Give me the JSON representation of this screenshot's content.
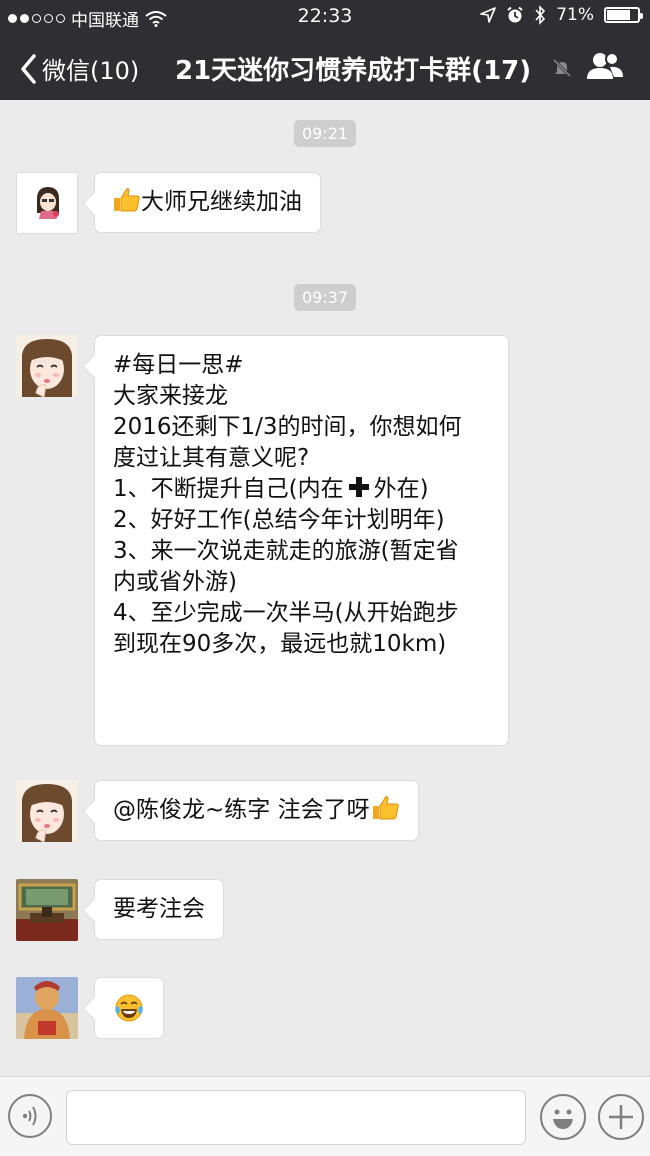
{
  "status_bar": {
    "carrier": "中国联通",
    "time": "22:33",
    "battery_text": "71%",
    "battery_level": 0.71
  },
  "nav": {
    "back_label": "微信(10)",
    "title": "21天迷你习惯养成打卡群(17)"
  },
  "messages": [
    {
      "timestamp": "09:21"
    },
    {
      "text": "大师兄继续加油",
      "lead_icon": "thumbs-up"
    },
    {
      "timestamp": "09:37"
    },
    {
      "lines": [
        "#每日一思#",
        "大家来接龙",
        "2016还剩下1/3的时间，你想如何",
        "度过让其有意义呢?",
        "1、不断提升自己(内在",
        "外在)",
        "2、好好工作(总结今年计划明年)",
        "3、来一次说走就走的旅游(暂定省",
        "内或省外游)",
        "4、至少完成一次半马(从开始跑步",
        "到现在90多次，最远也就10km)"
      ],
      "inline_icon": "plus"
    },
    {
      "text": "@陈俊龙~练字 注会了呀",
      "trail_icon": "thumbs-up"
    },
    {
      "text": "要考注会"
    },
    {
      "text": "",
      "icon": "tears-of-joy-emoji"
    }
  ],
  "colors": {
    "nav_background": "#2e2e33",
    "chat_background": "#ebebeb",
    "bubble": "#ffffff"
  }
}
